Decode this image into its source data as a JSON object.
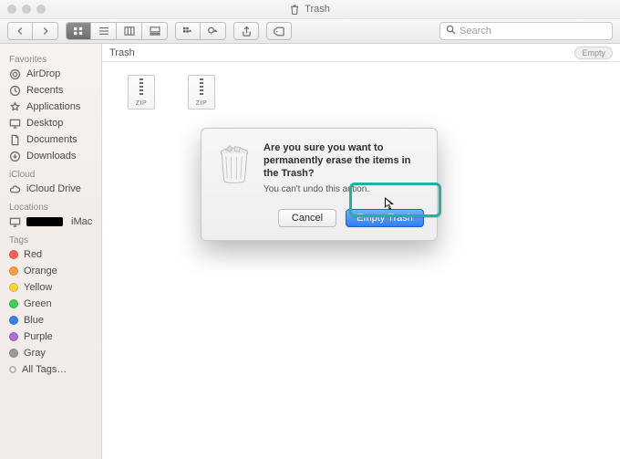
{
  "window": {
    "title": "Trash"
  },
  "toolbar": {
    "search_placeholder": "Search"
  },
  "pathbar": {
    "location": "Trash",
    "empty_label": "Empty"
  },
  "sidebar": {
    "favorites_head": "Favorites",
    "favorites": [
      {
        "label": "AirDrop"
      },
      {
        "label": "Recents"
      },
      {
        "label": "Applications"
      },
      {
        "label": "Desktop"
      },
      {
        "label": "Documents"
      },
      {
        "label": "Downloads"
      }
    ],
    "icloud_head": "iCloud",
    "icloud": [
      {
        "label": "iCloud Drive"
      }
    ],
    "locations_head": "Locations",
    "locations": [
      {
        "label": "iMac"
      }
    ],
    "tags_head": "Tags",
    "tags": [
      {
        "label": "Red",
        "color": "#ff5f57"
      },
      {
        "label": "Orange",
        "color": "#ff9e3d"
      },
      {
        "label": "Yellow",
        "color": "#ffd23a"
      },
      {
        "label": "Green",
        "color": "#3ecf55"
      },
      {
        "label": "Blue",
        "color": "#3a82f3"
      },
      {
        "label": "Purple",
        "color": "#b26bd8"
      },
      {
        "label": "Gray",
        "color": "#9a9a9a"
      },
      {
        "label": "All Tags…",
        "color": null
      }
    ]
  },
  "files": [
    {
      "ext": "ZIP",
      "name": " "
    },
    {
      "ext": "ZIP",
      "name": " "
    }
  ],
  "dialog": {
    "heading": "Are you sure you want to permanently erase the items in the Trash?",
    "sub": "You can't undo this action.",
    "cancel": "Cancel",
    "confirm": "Empty Trash"
  }
}
